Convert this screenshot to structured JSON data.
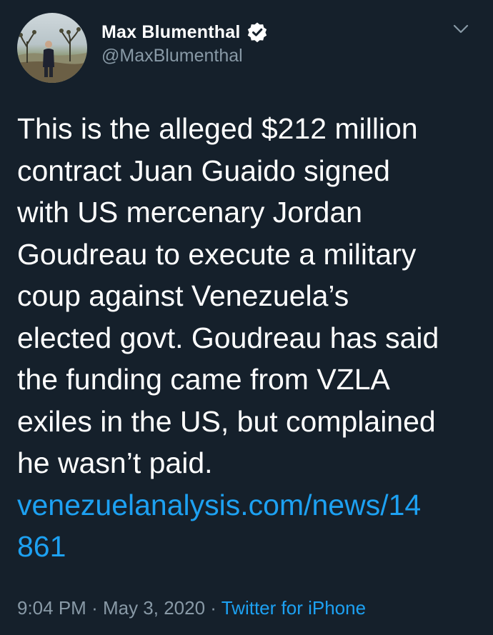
{
  "author": {
    "display_name": "Max Blumenthal",
    "handle": "@MaxBlumenthal",
    "verified": true
  },
  "tweet": {
    "lines": [
      "This is the alleged $212 million",
      "contract Juan Guaido signed",
      "with US mercenary Jordan",
      "Goudreau to execute a military",
      "coup against Venezuela’s",
      "elected govt. Goudreau has said",
      "the funding came from VZLA",
      "exiles in the US, but complained",
      "he wasn’t paid."
    ],
    "link_lines": [
      "venezuelanalysis.com/news/14",
      "861"
    ]
  },
  "meta": {
    "time": "9:04 PM",
    "separator": "·",
    "date": "May 3, 2020",
    "source": "Twitter for iPhone"
  },
  "icons": {
    "verified": "verified-badge-icon",
    "menu": "chevron-down-icon"
  },
  "colors": {
    "background": "#15202b",
    "text": "#ffffff",
    "secondary": "#8899a6",
    "link": "#1da1f2"
  }
}
